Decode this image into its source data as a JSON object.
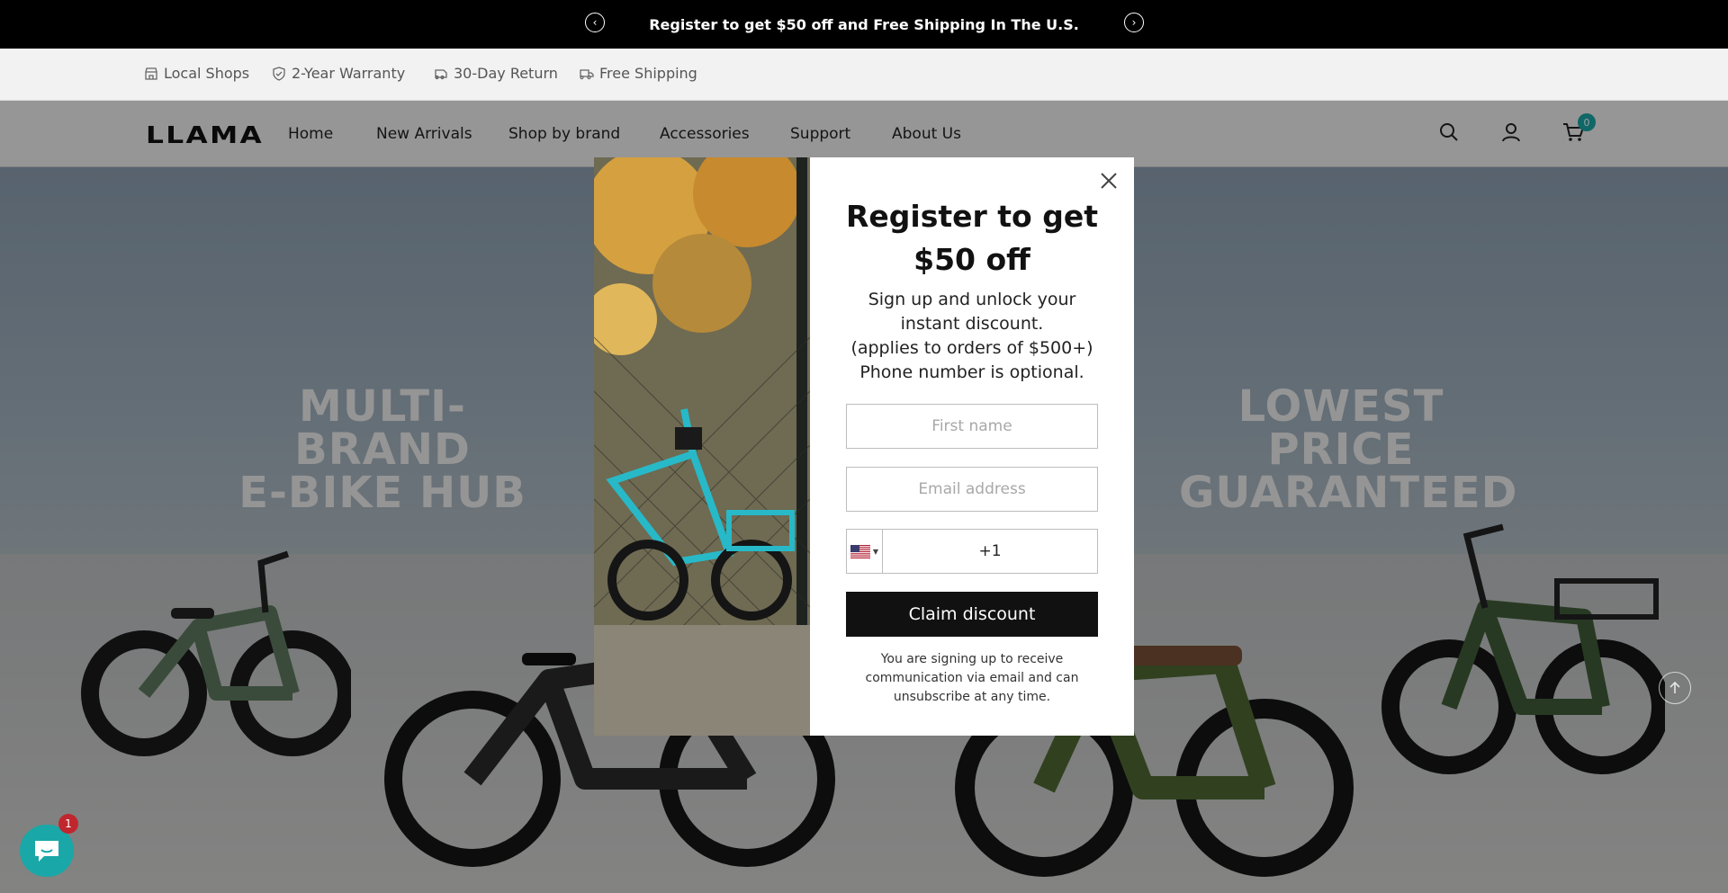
{
  "announcement": {
    "message": "Register to get $50 off and Free Shipping In The U.S.",
    "prev_icon": "chevron-left-icon",
    "next_icon": "chevron-right-icon"
  },
  "perks": [
    {
      "label": "Local Shops",
      "icon": "store-icon"
    },
    {
      "label": "2-Year Warranty",
      "icon": "shield-check-icon"
    },
    {
      "label": "30-Day Return",
      "icon": "return-icon"
    },
    {
      "label": "Free Shipping",
      "icon": "truck-icon"
    }
  ],
  "nav": {
    "logo": "LLAMA",
    "links": [
      "Home",
      "New Arrivals",
      "Shop by brand",
      "Accessories",
      "Support",
      "About Us"
    ],
    "cart_count": "0"
  },
  "hero": {
    "left_headline_1": "MULTI-BRAND",
    "left_headline_2": "E-BIKE HUB",
    "right_headline_1": "LOWEST PRICE",
    "right_headline_2": "GUARANTEED"
  },
  "modal": {
    "title_line_1": "Register to get",
    "title_line_2": "$50 off",
    "body_line_1": "Sign up and unlock your",
    "body_line_2": "instant discount.",
    "body_line_3": "(applies to orders of $500+)",
    "body_line_4": "Phone number is optional.",
    "first_name_placeholder": "First name",
    "email_placeholder": "Email address",
    "phone_prefix": "+1",
    "country_flag": "us-flag-icon",
    "claim_label": "Claim discount",
    "disclaimer": "You are signing up to receive communication via email and can unsubscribe at any time."
  },
  "chat": {
    "badge_count": "1"
  },
  "colors": {
    "announcement_bg": "#000000",
    "accent": "#1aa7a7",
    "button_bg": "#111111",
    "badge_red": "#c0262d"
  }
}
